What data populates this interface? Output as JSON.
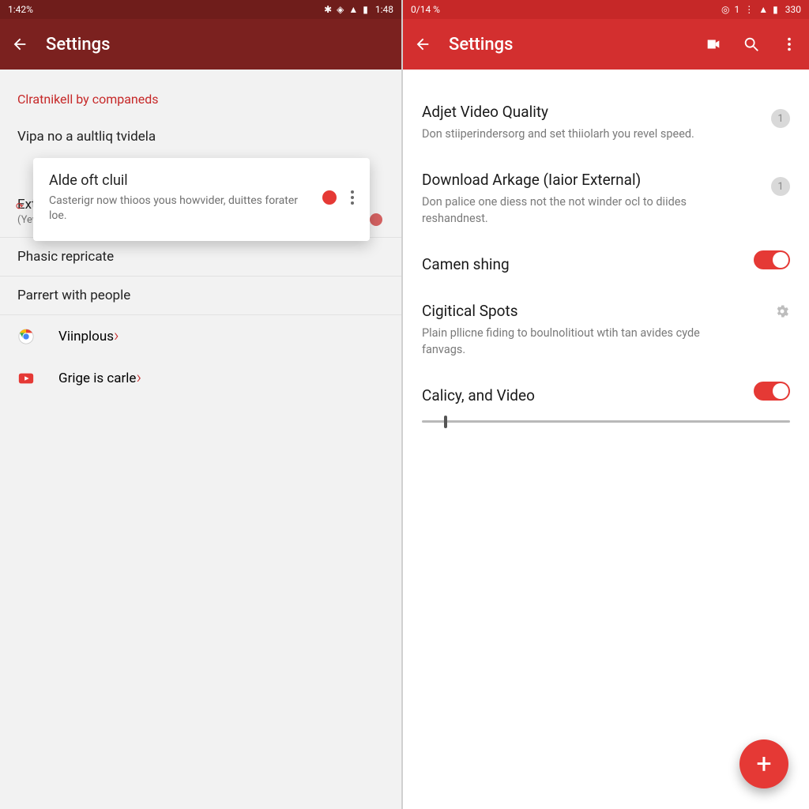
{
  "left": {
    "status": {
      "time": "1:42%",
      "right": "1:48"
    },
    "appbar": {
      "title": "Settings"
    },
    "section_header": "Clratnikell by companeds",
    "row_caption": "Vipa no a aultliq tvidela",
    "card": {
      "title": "Alde oft cluil",
      "body": "Casterigr now thioos yous howvider, duittes forater loe."
    },
    "rows": [
      {
        "title": "Extern with an commeletics",
        "sub": "(Yew sirme scee)",
        "toggle": true
      },
      {
        "title": "Phasic repricate"
      },
      {
        "title": "Parrert with people"
      }
    ],
    "links": [
      {
        "icon": "chrome",
        "label": "Viinplous"
      },
      {
        "icon": "youtube",
        "label": "Grige is carle"
      }
    ]
  },
  "right": {
    "status": {
      "time": "0/14 %",
      "right": "330"
    },
    "appbar": {
      "title": "Settings"
    },
    "items": [
      {
        "title": "Adjet Video Quality",
        "desc": "Don stiiperindersorg and set thiiolarh you revel speed.",
        "badge": "1"
      },
      {
        "title": "Download Arkage (Iaior External)",
        "desc": "Don palice one diess not the not winder ocl to diides reshandnest.",
        "badge": "1"
      },
      {
        "title": "Camen shing",
        "switch": true
      },
      {
        "title": "Cigitical Spots",
        "desc": "Plain pllicne fiding to boulnolitiout wtih tan avides cyde fanvags.",
        "gear": true
      },
      {
        "title": "Calicy, and Video",
        "switch": true
      }
    ],
    "slider_value": 6,
    "fab": "+"
  }
}
